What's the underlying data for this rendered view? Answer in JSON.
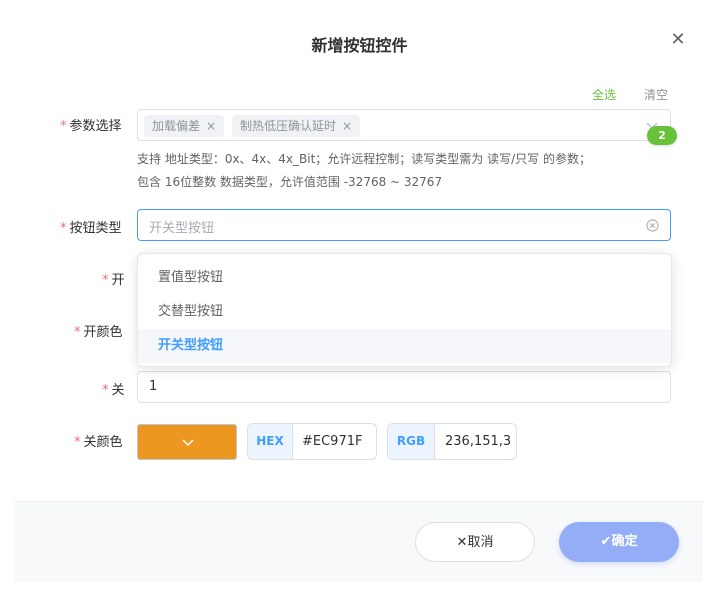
{
  "dialog": {
    "title": "新增按钮控件",
    "close_glyph": "✕"
  },
  "params": {
    "required_mark": "*",
    "label": "参数选择",
    "select_all": "全选",
    "clear": "清空",
    "tags": [
      "加载偏差",
      "制热低压确认延时"
    ],
    "tag_close_glyph": "×",
    "count_badge": "2",
    "hint_line1": "支持 地址类型：0x、4x、4x_Bit；允许远程控制；读写类型需为 读写/只写 的参数；",
    "hint_line2": "包含 16位整数 数据类型，允许值范围 -32768 ~ 32767",
    "select_all_color": "#67c23a",
    "clear_color": "#909399"
  },
  "button_type": {
    "label": "按钮类型",
    "placeholder": "开关型按钮",
    "clear_icon": "circle-x-icon",
    "options": [
      "置值型按钮",
      "交替型按钮",
      "开关型按钮"
    ],
    "selected_index": 2
  },
  "on_field": {
    "label": "开"
  },
  "on_color": {
    "label": "开颜色"
  },
  "off_field": {
    "label": "关",
    "value": "1"
  },
  "off_color": {
    "label": "关颜色",
    "swatch_color": "#EC971F",
    "hex_prefix": "HEX",
    "hex_value": "#EC971F",
    "rgb_prefix": "RGB",
    "rgb_value": "236,151,3"
  },
  "footer": {
    "cancel_label": "✕取消",
    "confirm_label": "✔确定",
    "confirm_color": "#93aef7"
  }
}
